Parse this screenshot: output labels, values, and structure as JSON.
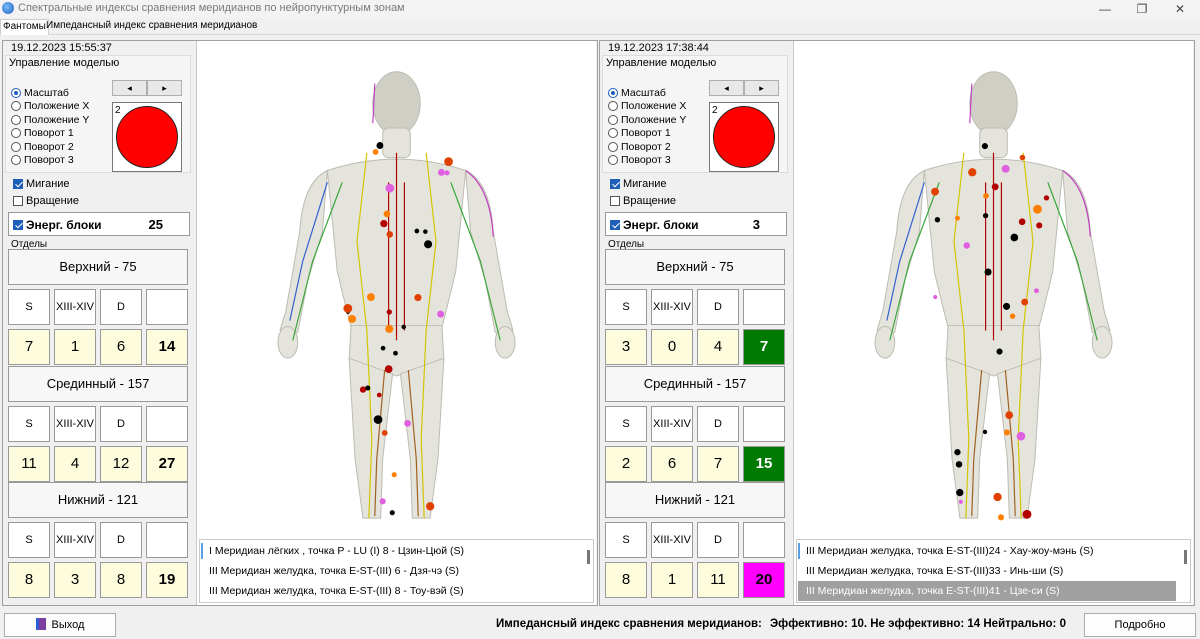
{
  "window": {
    "title": "Спектральные индексы сравнения меридианов по нейропунктурным зонам",
    "minimize": "—",
    "maximize": "❐",
    "close": "✕"
  },
  "tabs": [
    "Фантомы",
    "Импедансный индекс сравнения меридианов"
  ],
  "colors": {
    "red_light": "#ff0000",
    "green_total": "#007a00",
    "magenta_total": "#ff00ff"
  },
  "panels": [
    {
      "datetime": "19.12.2023 15:55:37",
      "model_group_label": "Управление моделью",
      "radios": [
        {
          "label": "Масштаб",
          "checked": true
        },
        {
          "label": "Положение X",
          "checked": false
        },
        {
          "label": "Положение Y",
          "checked": false
        },
        {
          "label": "Поворот 1",
          "checked": false
        },
        {
          "label": "Поворот 2",
          "checked": false
        },
        {
          "label": "Поворот 3",
          "checked": false
        }
      ],
      "arrow_left": "◂",
      "arrow_right": "▸",
      "light_number": "2",
      "blink_label": "Мигание",
      "blink_checked": true,
      "rotation_label": "Вращение",
      "rotation_checked": false,
      "energy_label": "Энерг. блоки",
      "energy_value": "25",
      "sections_label": "Отделы",
      "sections": [
        {
          "title": "Верхний - 75",
          "labels": [
            "S",
            "XIII-XIV",
            "D",
            ""
          ],
          "values": [
            "7",
            "1",
            "6",
            "14"
          ],
          "total_color": ""
        },
        {
          "title": "Срединный - 157",
          "labels": [
            "S",
            "XIII-XIV",
            "D",
            ""
          ],
          "values": [
            "11",
            "4",
            "12",
            "27"
          ],
          "total_color": ""
        },
        {
          "title": "Нижний - 121",
          "labels": [
            "S",
            "XIII-XIV",
            "D",
            ""
          ],
          "values": [
            "8",
            "3",
            "8",
            "19"
          ],
          "total_color": ""
        }
      ],
      "list": [
        "I Меридиан лёгких , точка  P - LU (I) 8 -  Цзин-Цюй (S)",
        "III Меридиан желудка, точка  E-ST-(III) 6 - Дзя-чэ (S)",
        "III Меридиан желудка, точка  E-ST-(III) 8 - Тоу-вэй (S)"
      ],
      "list_selected": -1
    },
    {
      "datetime": "19.12.2023 17:38:44",
      "model_group_label": "Управление моделью",
      "radios": [
        {
          "label": "Масштаб",
          "checked": true
        },
        {
          "label": "Положение X",
          "checked": false
        },
        {
          "label": "Положение Y",
          "checked": false
        },
        {
          "label": "Поворот 1",
          "checked": false
        },
        {
          "label": "Поворот 2",
          "checked": false
        },
        {
          "label": "Поворот 3",
          "checked": false
        }
      ],
      "arrow_left": "◂",
      "arrow_right": "▸",
      "light_number": "2",
      "blink_label": "Мигание",
      "blink_checked": true,
      "rotation_label": "Вращение",
      "rotation_checked": false,
      "energy_label": "Энерг. блоки",
      "energy_value": "3",
      "sections_label": "Отделы",
      "sections": [
        {
          "title": "Верхний - 75",
          "labels": [
            "S",
            "XIII-XIV",
            "D",
            ""
          ],
          "values": [
            "3",
            "0",
            "4",
            "7"
          ],
          "total_color": "#007a00"
        },
        {
          "title": "Срединный - 157",
          "labels": [
            "S",
            "XIII-XIV",
            "D",
            ""
          ],
          "values": [
            "2",
            "6",
            "7",
            "15"
          ],
          "total_color": "#007a00"
        },
        {
          "title": "Нижний - 121",
          "labels": [
            "S",
            "XIII-XIV",
            "D",
            ""
          ],
          "values": [
            "8",
            "1",
            "11",
            "20"
          ],
          "total_color": "#ff00ff"
        }
      ],
      "list": [
        "III Меридиан желудка, точка  E-ST-(III)24 - Хау-жоу-мэнь (S)",
        "III Меридиан желудка, точка  E-ST-(III)33 - Инь-ши (S)",
        "III Меридиан желудка, точка  E-ST-(III)41 - Цзе-си (S)"
      ],
      "list_selected": 2
    }
  ],
  "footer": {
    "exit_label": "Выход",
    "index_label": "Импедансный индекс сравнения меридианов:",
    "summary": "Эффективно: 10. Не эффективно: 14  Нейтрально: 0",
    "details_label": "Подробно"
  }
}
